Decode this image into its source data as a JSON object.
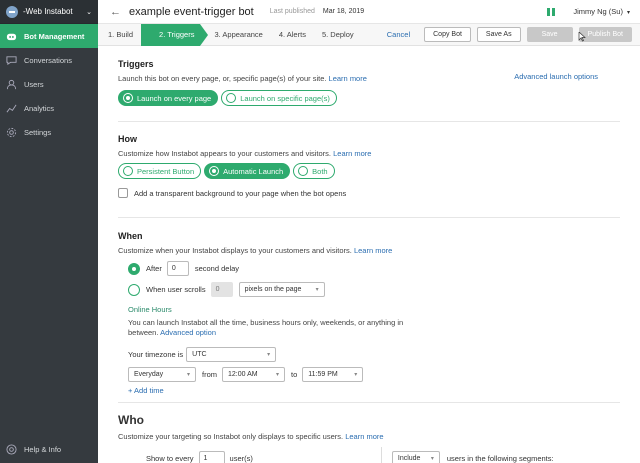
{
  "sidebar": {
    "workspace": "-Web Instabot",
    "items": [
      {
        "label": "Bot Management",
        "icon": "bot-icon"
      },
      {
        "label": "Conversations",
        "icon": "chat-icon"
      },
      {
        "label": "Users",
        "icon": "user-icon"
      },
      {
        "label": "Analytics",
        "icon": "analytics-icon"
      },
      {
        "label": "Settings",
        "icon": "gear-icon"
      }
    ],
    "help": "Help & Info"
  },
  "header": {
    "back": "←",
    "bot_name": "example event-trigger bot",
    "published_label": "Last published",
    "published_date": "Mar 18, 2019",
    "user_name": "Jimmy Ng (Su)"
  },
  "steps": [
    "1. Build",
    "2. Triggers",
    "3. Appearance",
    "4. Alerts",
    "5. Deploy"
  ],
  "actions": {
    "cancel": "Cancel",
    "copy": "Copy Bot",
    "save_as": "Save As",
    "save": "Save",
    "publish": "Publish Bot"
  },
  "triggers": {
    "title": "Triggers",
    "desc": "Launch this bot on every page, or, specific page(s) of your site.",
    "learn": "Learn more",
    "advanced": "Advanced launch options",
    "opt_every": "Launch on every page",
    "opt_specific": "Launch on specific page(s)"
  },
  "how": {
    "title": "How",
    "desc": "Customize how Instabot appears to your customers and visitors.",
    "learn": "Learn more",
    "opt_persistent": "Persistent Button",
    "opt_auto": "Automatic Launch",
    "opt_both": "Both",
    "checkbox": "Add a transparent background to your page when the bot opens"
  },
  "when": {
    "title": "When",
    "desc": "Customize when your Instabot displays to your customers and visitors.",
    "learn": "Learn more",
    "after": "After",
    "delay_value": "0",
    "delay_unit": "second delay",
    "scrolls": "When user scrolls",
    "scroll_value": "0",
    "scroll_unit": "pixels on the page",
    "online_title": "Online Hours",
    "online_desc": "You can launch Instabot all the time, business hours only, weekends, or anything in between.",
    "advanced": "Advanced option",
    "tz_label": "Your timezone is",
    "tz_value": "UTC",
    "day": "Everyday",
    "from": "from",
    "start": "12:00 AM",
    "to": "to",
    "end": "11:59 PM",
    "add_time": "+ Add time"
  },
  "who": {
    "title": "Who",
    "desc": "Customize your targeting so Instabot only displays to specific users.",
    "learn": "Learn more",
    "show": "Show to every",
    "every_value": "1",
    "users": "user(s)",
    "include": "Include",
    "segments": "users in the following segments:"
  }
}
